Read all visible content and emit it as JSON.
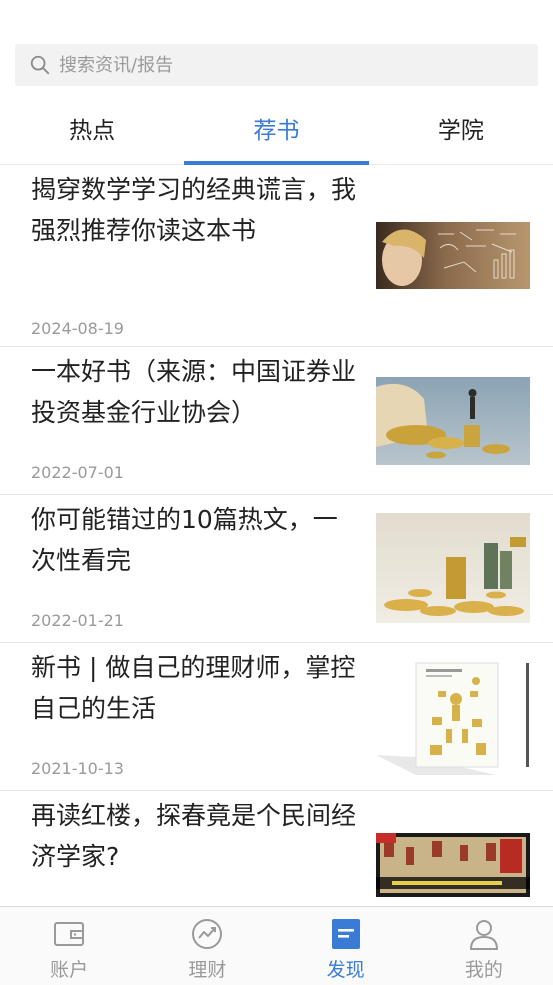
{
  "search": {
    "placeholder": "搜索资讯/报告",
    "icon": "search-icon"
  },
  "tabs": [
    {
      "label": "热点",
      "active": false
    },
    {
      "label": "荐书",
      "active": true
    },
    {
      "label": "学院",
      "active": false
    }
  ],
  "articles": [
    {
      "title": "揭穿数学学习的经典谎言，我强烈推荐你读这本书",
      "date": "2024-08-19",
      "image": "child-math-formulas-photo"
    },
    {
      "title": "一本好书（来源：中国证券业投资基金行业协会）",
      "date": "2022-07-01",
      "image": "gold-coins-businessman-figure-photo"
    },
    {
      "title": "你可能错过的10篇热文，一次性看完",
      "date": "2022-01-21",
      "image": "gold-coins-stacks-photo"
    },
    {
      "title": "新书 | 做自己的理财师，掌控自己的生活",
      "date": "2021-10-13",
      "image": "book-cover-illustration"
    },
    {
      "title": "再读红楼，探春竟是个民间经济学家?",
      "date": "",
      "image": "red-mansion-painting-banner"
    }
  ],
  "bottom_nav": [
    {
      "label": "账户",
      "icon": "wallet-icon",
      "active": false
    },
    {
      "label": "理财",
      "icon": "trend-circle-icon",
      "active": false
    },
    {
      "label": "发现",
      "icon": "discover-doc-icon",
      "active": true
    },
    {
      "label": "我的",
      "icon": "user-icon",
      "active": false
    }
  ],
  "colors": {
    "accent": "#3a7bd5",
    "text": "#222222",
    "muted": "#9a9a9a",
    "search_bg": "#f2f2f2"
  }
}
